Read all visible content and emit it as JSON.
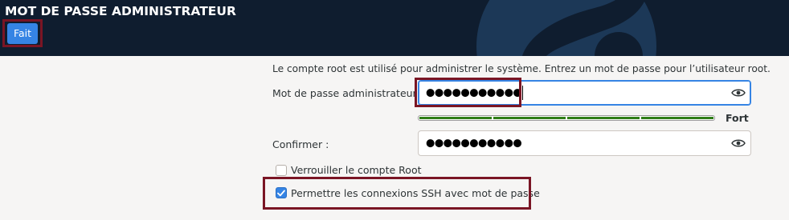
{
  "header": {
    "title": "MOT DE PASSE ADMINISTRATEUR",
    "done_label": "Fait"
  },
  "main": {
    "description": "Le compte root est utilisé pour administrer le système. Entrez un mot de passe pour l’utilisateur root.",
    "password": {
      "label": "Mot de passe administrateur :",
      "value_masked": "●●●●●●●●●●●",
      "icon": "eye-icon"
    },
    "strength": {
      "label": "Fort",
      "level": 1.0,
      "color": "#2e7d16"
    },
    "confirm": {
      "label": "Confirmer :",
      "value_masked": "●●●●●●●●●●●",
      "icon": "eye-icon"
    },
    "lock_root": {
      "label": "Verrouiller le compte Root",
      "checked": false
    },
    "allow_ssh": {
      "label": "Permettre les connexions SSH avec mot de passe",
      "checked": true
    }
  },
  "colors": {
    "header_bg": "#0f1d2f",
    "accent": "#3584e4",
    "annotation": "#7a1524"
  }
}
